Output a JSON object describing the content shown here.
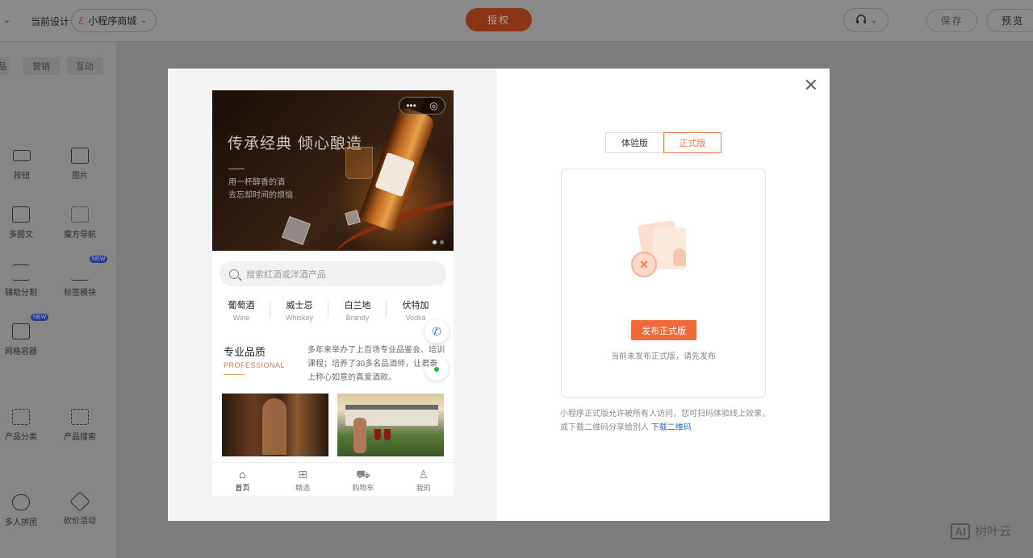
{
  "topbar": {
    "design_label": "当前设计",
    "project_name": "小程序商城",
    "auth_label": "授权",
    "save_label": "保存",
    "preview_label": "预览"
  },
  "sidebar": {
    "tabs": [
      "品",
      "营销",
      "互动"
    ],
    "items": [
      {
        "label": "按钮",
        "icon": "button-icon"
      },
      {
        "label": "图片",
        "icon": "image-icon"
      },
      {
        "label": "多图文",
        "icon": "multi-image-text-icon"
      },
      {
        "label": "魔方导航",
        "icon": "grid-nav-icon"
      },
      {
        "label": "辅助分割",
        "icon": "divider-icon"
      },
      {
        "label": "标签模块",
        "icon": "tag-module-icon",
        "badge": "NEW"
      },
      {
        "label": "网格容器",
        "icon": "grid-container-icon",
        "badge": "NEW"
      },
      {
        "label": "产品分类",
        "icon": "product-category-icon"
      },
      {
        "label": "产品搜索",
        "icon": "product-search-icon"
      },
      {
        "label": "多人拼团",
        "icon": "group-buy-icon"
      },
      {
        "label": "砍价活动",
        "icon": "bargain-icon"
      }
    ]
  },
  "phone": {
    "banner": {
      "title": "传承经典 倾心酿造",
      "sub1": "用一杯醇香的酒",
      "sub2": "去忘却时间的烦恼",
      "capsule_more": "•••",
      "capsule_close": "◎"
    },
    "search_placeholder": "搜索红酒或洋酒产品",
    "categories": [
      {
        "cn": "葡萄酒",
        "en": "Wine"
      },
      {
        "cn": "威士忌",
        "en": "Whiskey"
      },
      {
        "cn": "白兰地",
        "en": "Brandy"
      },
      {
        "cn": "伏特加",
        "en": "Vodka"
      }
    ],
    "section": {
      "title": "专业品质",
      "subtitle": "PROFESSIONAL",
      "description": "多年来举办了上百场专业品鉴会、培训课程；培养了30多名品酒师，让君泰上称心如意的真爱酒款。"
    },
    "tabbar": [
      {
        "label": "首页",
        "icon": "home-icon"
      },
      {
        "label": "精选",
        "icon": "grid-icon"
      },
      {
        "label": "购物车",
        "icon": "cart-icon"
      },
      {
        "label": "我的",
        "icon": "user-icon"
      }
    ]
  },
  "publish": {
    "tab_trial": "体验版",
    "tab_official": "正式版",
    "publish_button": "发布正式版",
    "empty_note": "当前未发布正式版，请先发布",
    "desc": "小程序正式版允许被所有人访问，您可扫码体验线上效果，或下载二维码分享给别人",
    "download_link": "下载二维码"
  },
  "watermark": {
    "logo": "AI",
    "text": "树叶云"
  },
  "colors": {
    "accent": "#f2693a",
    "link": "#2a6ad0",
    "auth_button": "#8a3516"
  }
}
